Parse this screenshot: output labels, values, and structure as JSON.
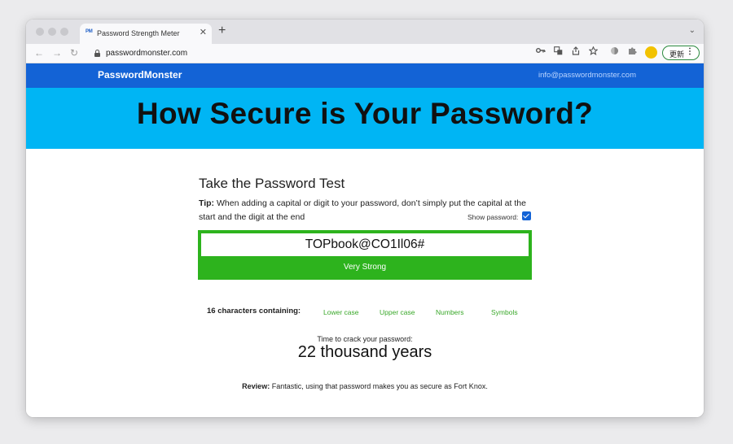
{
  "browser": {
    "tab_title": "Password Strength Meter",
    "tab_favicon_text": "PM",
    "close_glyph": "✕",
    "new_tab_glyph": "+",
    "tab_menu_glyph": "⌄",
    "back_glyph": "←",
    "forward_glyph": "→",
    "reload_glyph": "↻",
    "url": "passwordmonster.com",
    "update_label": "更新",
    "menu_glyph": "⋮",
    "icons": [
      "key-icon",
      "translate-icon",
      "share-icon",
      "star-icon",
      "extension-icon",
      "puzzle-icon"
    ]
  },
  "site": {
    "brand": "PasswordMonster",
    "email": "info@passwordmonster.com",
    "hero_title": "How Secure is Your Password?"
  },
  "test": {
    "title": "Take the Password Test",
    "tip_label": "Tip:",
    "tip_text": "When adding a capital or digit to your password, don’t simply put the capital at the start and the digit at the end",
    "show_password_label": "Show password:",
    "show_password_checked": true,
    "password_value": "TOPbook@CO1Il06#",
    "strength_label": "Very Strong",
    "characters_summary": "16 characters containing:",
    "categories": [
      "Lower case",
      "Upper case",
      "Numbers",
      "Symbols"
    ],
    "crack_label": "Time to crack your password:",
    "crack_value": "22 thousand years",
    "review_label": "Review:",
    "review_text": "Fantastic, using that password makes you as secure as Fort Knox."
  },
  "colors": {
    "nav_blue": "#1363d6",
    "hero_cyan": "#00b5f4",
    "strength_green": "#2db31d",
    "category_green": "#3aa82a"
  }
}
